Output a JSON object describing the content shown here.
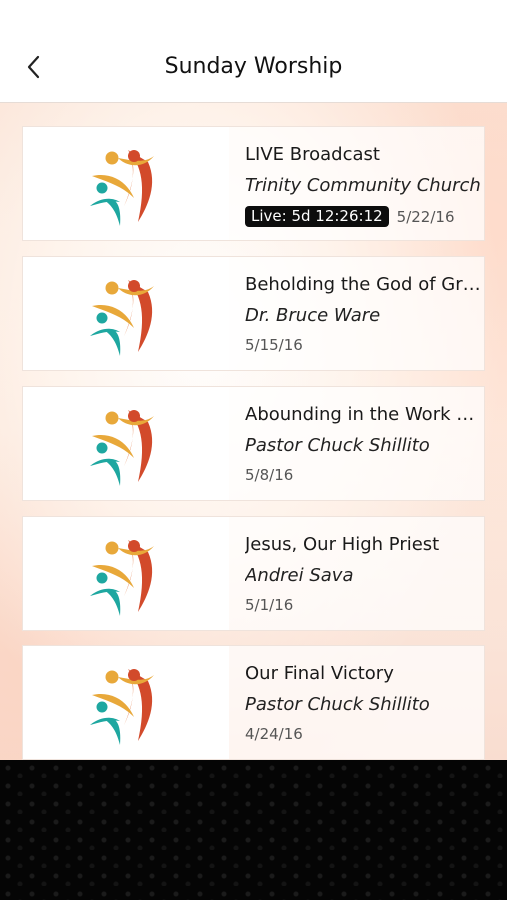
{
  "header": {
    "title": "Sunday Worship",
    "back_icon": "chevron-left-icon"
  },
  "colors": {
    "logo_orange": "#e8a83a",
    "logo_red": "#d24a2b",
    "logo_teal": "#1ea7a0",
    "badge_bg": "#0d0d0d",
    "footer_bg": "#050505"
  },
  "items": [
    {
      "title": "LIVE Broadcast",
      "speaker": "Trinity Community Church",
      "live_badge": "Live: 5d 12:26:12",
      "date": "5/22/16"
    },
    {
      "title": "Beholding the God of Grace",
      "speaker": "Dr.  Bruce Ware",
      "date": "5/15/16"
    },
    {
      "title": "Abounding in the Work of the Lord",
      "speaker": "Pastor Chuck Shillito",
      "date": "5/8/16"
    },
    {
      "title": "Jesus,  Our High Priest",
      "speaker": "Andrei Sava",
      "date": "5/1/16"
    },
    {
      "title": "Our Final Victory",
      "speaker": "Pastor Chuck Shillito",
      "date": "4/24/16"
    }
  ]
}
